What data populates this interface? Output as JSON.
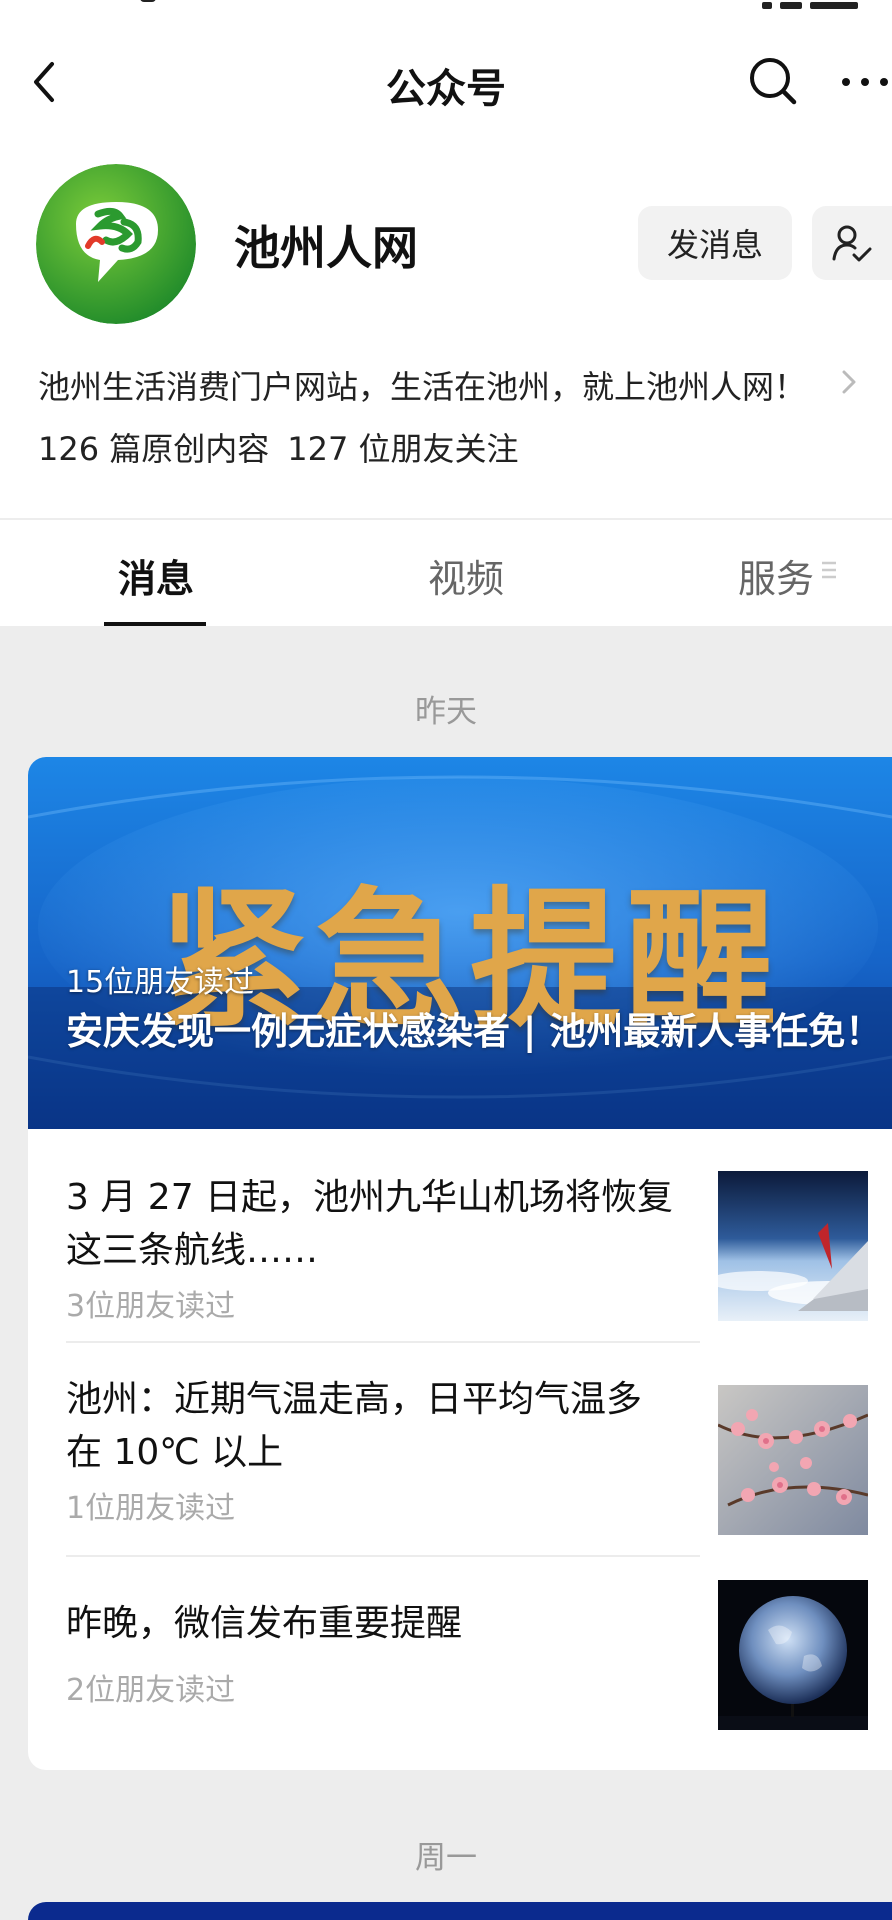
{
  "navbar": {
    "title": "公众号",
    "icons": {
      "back": "back-arrow-icon",
      "search": "search-icon",
      "more": "more-dots-icon"
    }
  },
  "profile": {
    "name": "池州人网",
    "send_message_label": "发消息",
    "follow_icon": "user-check-icon",
    "description": "池州生活消费门户网站，生活在池州，就上池州人网！",
    "stats_original": "126 篇原创内容",
    "stats_followers": "127 位朋友关注"
  },
  "tabs": [
    {
      "label": "消息",
      "active": true
    },
    {
      "label": "视频",
      "active": false
    },
    {
      "label": "服务",
      "active": false
    }
  ],
  "feed": {
    "date_1": "昨天",
    "hero": {
      "banner_text": "紧急提醒",
      "read_count": "15位朋友读过",
      "title": "安庆发现一例无症状感染者 | 池州最新人事任免！"
    },
    "articles": [
      {
        "title": "3 月 27 日起，池州九华山机场将恢复这三条航线……",
        "read_count": "3位朋友读过",
        "thumb": "airplane-wing-image"
      },
      {
        "title": "池州：近期气温走高，日平均气温多在 10℃ 以上",
        "read_count": "1位朋友读过",
        "thumb": "plum-blossom-image"
      },
      {
        "title": "昨晚，微信发布重要提醒",
        "read_count": "2位朋友读过",
        "thumb": "earth-image"
      }
    ],
    "date_2": "周一"
  },
  "colors": {
    "accent_text": "#111111",
    "muted": "#999999",
    "hero_blue": "#1a6fd8",
    "hero_gold": "#e0a64a",
    "background": "#ededed"
  }
}
